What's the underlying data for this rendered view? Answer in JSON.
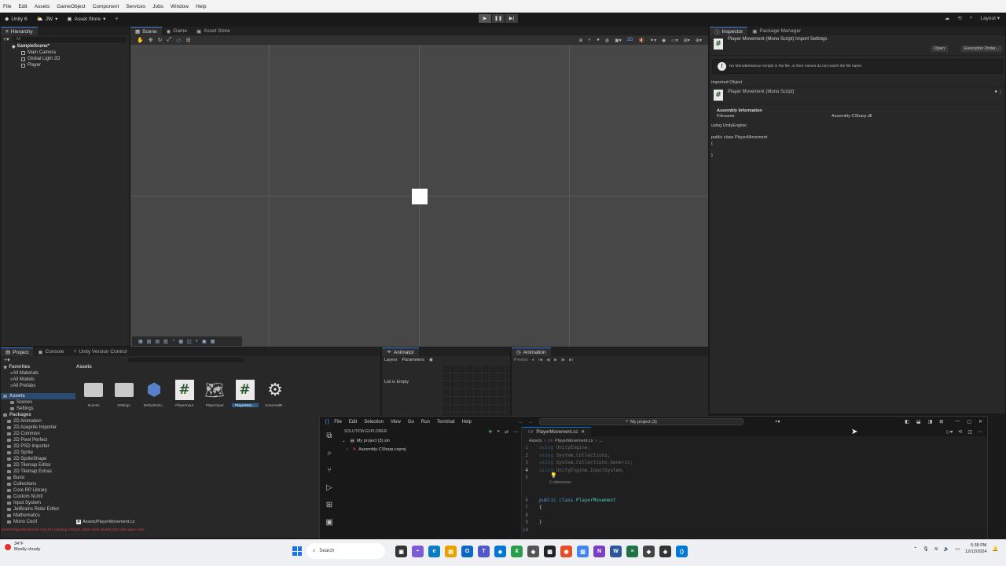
{
  "menubar": {
    "items": [
      "File",
      "Edit",
      "Assets",
      "GameObject",
      "Component",
      "Services",
      "Jobs",
      "Window",
      "Help"
    ]
  },
  "toolbar": {
    "app": "Unity 6",
    "account": "JW",
    "asset_store": "Asset Store",
    "layout": "Layout"
  },
  "hierarchy": {
    "tab": "Hierarchy",
    "search_placeholder": "All",
    "scene": "SampleScene*",
    "objects": [
      "Main Camera",
      "Global Light 2D",
      "Player"
    ]
  },
  "scene_tabs": {
    "scene": "Scene",
    "game": "Game",
    "asset_store": "Asset Store"
  },
  "scene_toolbar": {
    "mode_2d": "2D"
  },
  "inspector": {
    "tabs": [
      "Inspector",
      "Package Manager"
    ],
    "title": "Player Movement (Mono Script) Import Settings",
    "open_btn": "Open",
    "exec_btn": "Execution Order...",
    "warning": "No MonoBehaviour scripts in the file, or their names do not match the file name.",
    "imported_label": "Imported Object",
    "imported_name": "Player Movement (Mono Script)",
    "assembly_header": "Assembly Information",
    "filename_label": "Filename",
    "filename_value": "Assembly-CSharp.dll",
    "preview_lines": [
      "using UnityEngine;",
      "",
      "public class PlayerMovement",
      "{",
      "",
      "}"
    ]
  },
  "project": {
    "tabs": [
      "Project",
      "Console",
      "Unity Version Control"
    ],
    "favorites_label": "Favorites",
    "favorites": [
      "All Materials",
      "All Models",
      "All Prefabs"
    ],
    "assets_label": "Assets",
    "asset_children": [
      "Scenes",
      "Settings"
    ],
    "packages_label": "Packages",
    "packages": [
      "2D Animation",
      "2D Aseprite Importer",
      "2D Common",
      "2D Pixel Perfect",
      "2D PSD Importer",
      "2D Sprite",
      "2D SpriteShape",
      "2D Tilemap Editor",
      "2D Tilemap Extras",
      "Burst",
      "Collections",
      "Core RP Library",
      "Custom NUnit",
      "Input System",
      "JetBrains Rider Editor",
      "Mathematics",
      "Mono Cecil"
    ],
    "breadcrumb": "Assets",
    "items": [
      "Scenes",
      "Settings",
      "DefaultVolu...",
      "PlayerInput",
      "PlayerInput",
      "PlayerMov...",
      "UniversalR..."
    ],
    "footer_path": "Assets/PlayerMovement.cs",
    "error_text": "Assets\\PlayerMovement.cs(6,14): warning CS0114 class name should start with upper case"
  },
  "animator": {
    "tab": "Animator",
    "layers": "Layers",
    "parameters": "Parameters",
    "empty": "List is Empty"
  },
  "animation": {
    "tab": "Animation",
    "preview": "Preview"
  },
  "vscode": {
    "menu": [
      "File",
      "Edit",
      "Selection",
      "View",
      "Go",
      "Run",
      "Terminal",
      "Help"
    ],
    "search": "My project (3)",
    "explorer_title": "SOLUTION EXPLORER",
    "tree": [
      "My project (3).sln",
      "Assembly-CSharp.csproj"
    ],
    "tab": "PlayerMovement.cs",
    "breadcrumb_root": "Assets",
    "breadcrumb_file": "PlayerMovement.cs",
    "breadcrumb_more": "...",
    "references": "0 references"
  },
  "code": [
    {
      "n": "1",
      "parts": [
        {
          "t": "using ",
          "c": "kw dim"
        },
        {
          "t": "UnityEngine;",
          "c": "dim"
        }
      ]
    },
    {
      "n": "2",
      "parts": [
        {
          "t": "using ",
          "c": "kw dim"
        },
        {
          "t": "System.Collections;",
          "c": "dim"
        }
      ]
    },
    {
      "n": "3",
      "parts": [
        {
          "t": "using ",
          "c": "kw dim"
        },
        {
          "t": "System.Collections.Generic;",
          "c": "dim"
        }
      ]
    },
    {
      "n": "4",
      "parts": [
        {
          "t": "using ",
          "c": "kw dim"
        },
        {
          "t": "UnityEngine.InputSystem;",
          "c": "dim"
        }
      ]
    },
    {
      "n": "5",
      "parts": []
    },
    {
      "n": "6",
      "parts": [
        {
          "t": "public ",
          "c": "kw"
        },
        {
          "t": "class ",
          "c": "kw"
        },
        {
          "t": "PlayerMovement",
          "c": "ty"
        }
      ]
    },
    {
      "n": "7",
      "parts": [
        {
          "t": "{",
          "c": ""
        }
      ]
    },
    {
      "n": "8",
      "parts": []
    },
    {
      "n": "9",
      "parts": [
        {
          "t": "}",
          "c": ""
        }
      ]
    },
    {
      "n": "10",
      "parts": []
    }
  ],
  "taskbar": {
    "temp": "34°F",
    "weather": "Mostly cloudy",
    "search": "Search",
    "time": "5:38 PM",
    "date": "12/12/2024"
  }
}
